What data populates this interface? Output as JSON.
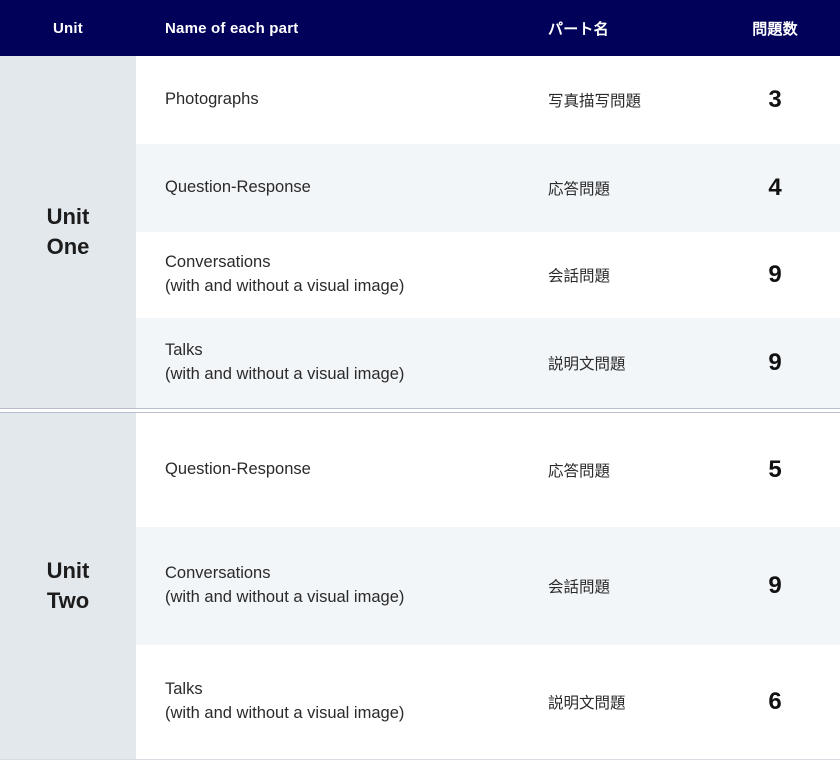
{
  "table": {
    "header": {
      "unit": "Unit",
      "name": "Name of each part",
      "jp_name": "パート名",
      "count": "問題数"
    },
    "colors": {
      "header_bg": "#010159",
      "header_text": "#ffffff",
      "unit_cell_bg": "#e3e8ed",
      "row_bg": "#ffffff",
      "row_alt_bg": "#f2f6f9",
      "divider": "#b8bfcb",
      "text": "#2a2a2a"
    },
    "units": [
      {
        "label_line1": "Unit",
        "label_line2": "One",
        "rows": [
          {
            "name_line1": "Photographs",
            "name_line2": "",
            "jp": "写真描写問題",
            "count": "3"
          },
          {
            "name_line1": "Question-Response",
            "name_line2": "",
            "jp": "応答問題",
            "count": "4"
          },
          {
            "name_line1": "Conversations",
            "name_line2": "(with and without a visual image)",
            "jp": "会話問題",
            "count": "9"
          },
          {
            "name_line1": "Talks",
            "name_line2": "(with and without a visual image)",
            "jp": "説明文問題",
            "count": "9"
          }
        ]
      },
      {
        "label_line1": "Unit",
        "label_line2": "Two",
        "rows": [
          {
            "name_line1": "Question-Response",
            "name_line2": "",
            "jp": "応答問題",
            "count": "5"
          },
          {
            "name_line1": "Conversations",
            "name_line2": "(with and without a visual image)",
            "jp": "会話問題",
            "count": "9"
          },
          {
            "name_line1": "Talks",
            "name_line2": "(with and without a visual image)",
            "jp": "説明文問題",
            "count": "6"
          }
        ]
      }
    ]
  }
}
